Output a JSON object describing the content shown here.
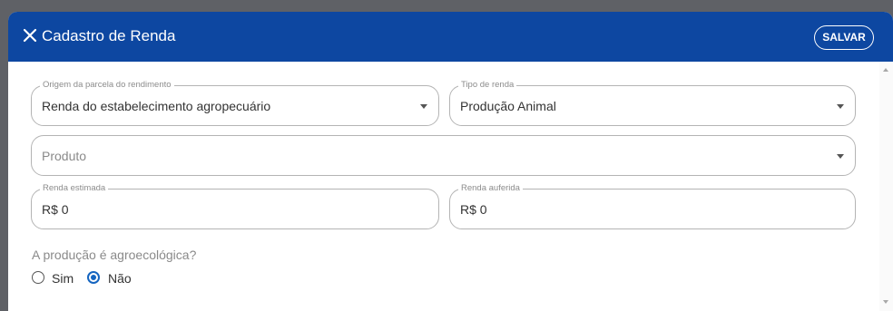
{
  "dialog": {
    "title": "Cadastro de Renda",
    "save_label": "SALVAR",
    "icons": {
      "close": "close-icon"
    },
    "colors": {
      "header": "#0d47a1",
      "accent": "#1565c0"
    }
  },
  "form": {
    "origem": {
      "label": "Origem da parcela do rendimento",
      "value": "Renda do estabelecimento agropecuário"
    },
    "tipo": {
      "label": "Tipo de renda",
      "value": "Produção Animal"
    },
    "produto": {
      "placeholder": "Produto"
    },
    "renda_estimada": {
      "label": "Renda estimada",
      "value": "R$ 0"
    },
    "renda_auferida": {
      "label": "Renda auferida",
      "value": "R$ 0"
    },
    "agroecologica": {
      "question": "A produção é agroecológica?",
      "options": [
        {
          "label": "Sim",
          "selected": false
        },
        {
          "label": "Não",
          "selected": true
        }
      ]
    }
  }
}
